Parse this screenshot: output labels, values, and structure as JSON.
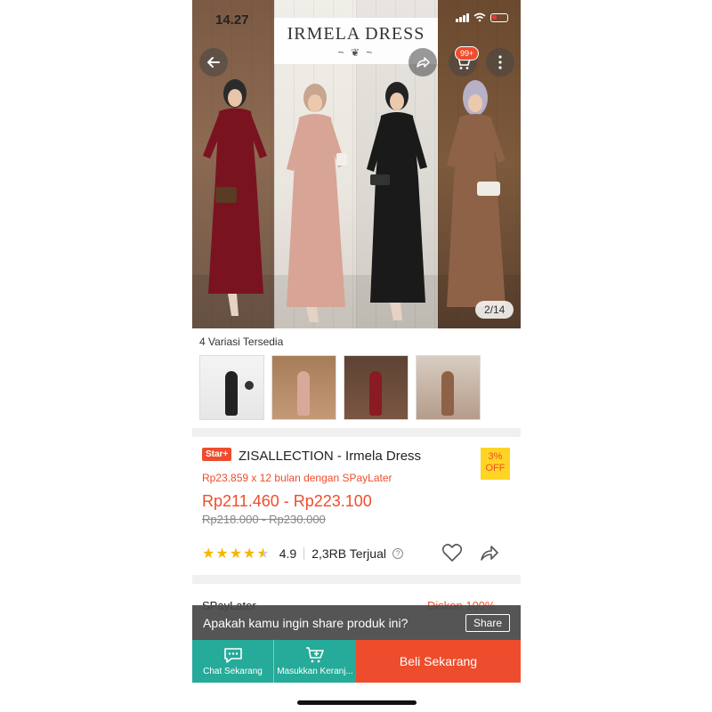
{
  "status_bar": {
    "time": "14.27"
  },
  "hero": {
    "title": "IRMELA DRESS",
    "flourish": "~ ❦ ~",
    "pager": "2/14",
    "cart_badge": "99+"
  },
  "variations": {
    "label": "4 Variasi Tersedia",
    "count": 4
  },
  "product": {
    "badge": "Star+",
    "title": "ZISALLECTION - Irmela Dress",
    "discount": "3%",
    "discount_suffix": "OFF",
    "installment": "Rp23.859 x 12 bulan dengan SPayLater",
    "price_range": "Rp211.460 - Rp223.100",
    "original_price_range": "Rp218.000 - Rp230.000",
    "rating": "4.9",
    "stars": 4.5,
    "sold": "2,3RB Terjual"
  },
  "spaylater": {
    "label": "SPayLater",
    "promo": "Diskon 100%"
  },
  "share_prompt": {
    "text": "Apakah kamu ingin share produk ini?",
    "button": "Share"
  },
  "bottom_bar": {
    "chat_label": "Chat Sekarang",
    "cart_label": "Masukkan Keranj...",
    "buy_label": "Beli Sekarang"
  },
  "colors": {
    "brand": "#ee4d2d",
    "teal": "#26aa99",
    "star": "#f6b600"
  }
}
